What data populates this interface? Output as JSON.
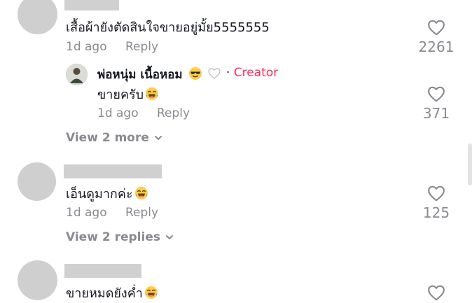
{
  "comments": [
    {
      "text": "เสื้อผ้ายังตัดสินใจขายอยู่มั้ย5555555",
      "time": "1d ago",
      "reply_label": "Reply",
      "likes": "2261",
      "reply": {
        "author": "พ่อหนุ่ม เนื้อหอม",
        "badge_separator": "·",
        "badge": "Creator",
        "text": "ขายครับ",
        "time": "1d ago",
        "reply_label": "Reply",
        "likes": "371"
      },
      "view_more": "View 2 more"
    },
    {
      "text": "เอ็นดูมากค่ะ",
      "time": "1d ago",
      "reply_label": "Reply",
      "likes": "125",
      "view_more": "View 2 replies"
    },
    {
      "text": "ขายหมดยังค่ำ"
    }
  ],
  "colors": {
    "accent": "#fe2c55",
    "muted": "#8a8b91",
    "text": "#161823"
  },
  "icons": [
    "heart-icon",
    "chevron-down-icon",
    "laughing-emoji-icon",
    "sunglasses-emoji-icon",
    "white-heart-emoji-icon"
  ]
}
